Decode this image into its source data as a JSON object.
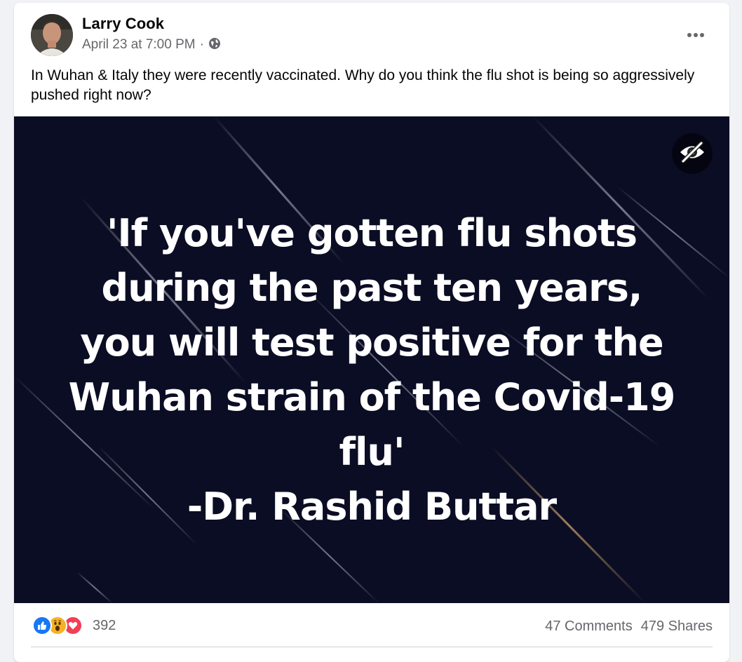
{
  "post": {
    "author": "Larry Cook",
    "date": "April 23 at 7:00 PM",
    "separator": "·",
    "privacy_icon": "globe-icon",
    "more_icon": "more-options-icon",
    "text": "In Wuhan & Italy they were recently vaccinated. Why do you think the flu shot is being so aggressively pushed right now?"
  },
  "image": {
    "background_color": "#0b0d24",
    "quote_lines": [
      "'If you've gotten flu shots",
      "during the past ten years,",
      "you will test positive for the",
      "Wuhan strain of the Covid-19",
      "flu'",
      "-Dr. Rashid Buttar"
    ],
    "hide_icon": "eye-slash-icon"
  },
  "engagement": {
    "reaction_icons": [
      "like-icon",
      "wow-icon",
      "love-icon"
    ],
    "reaction_count": "392",
    "comments": "47 Comments",
    "shares": "479 Shares"
  },
  "colors": {
    "like": "#1877f2",
    "wow": "#f7b125",
    "love": "#f33e58",
    "secondary_text": "#65676b"
  }
}
